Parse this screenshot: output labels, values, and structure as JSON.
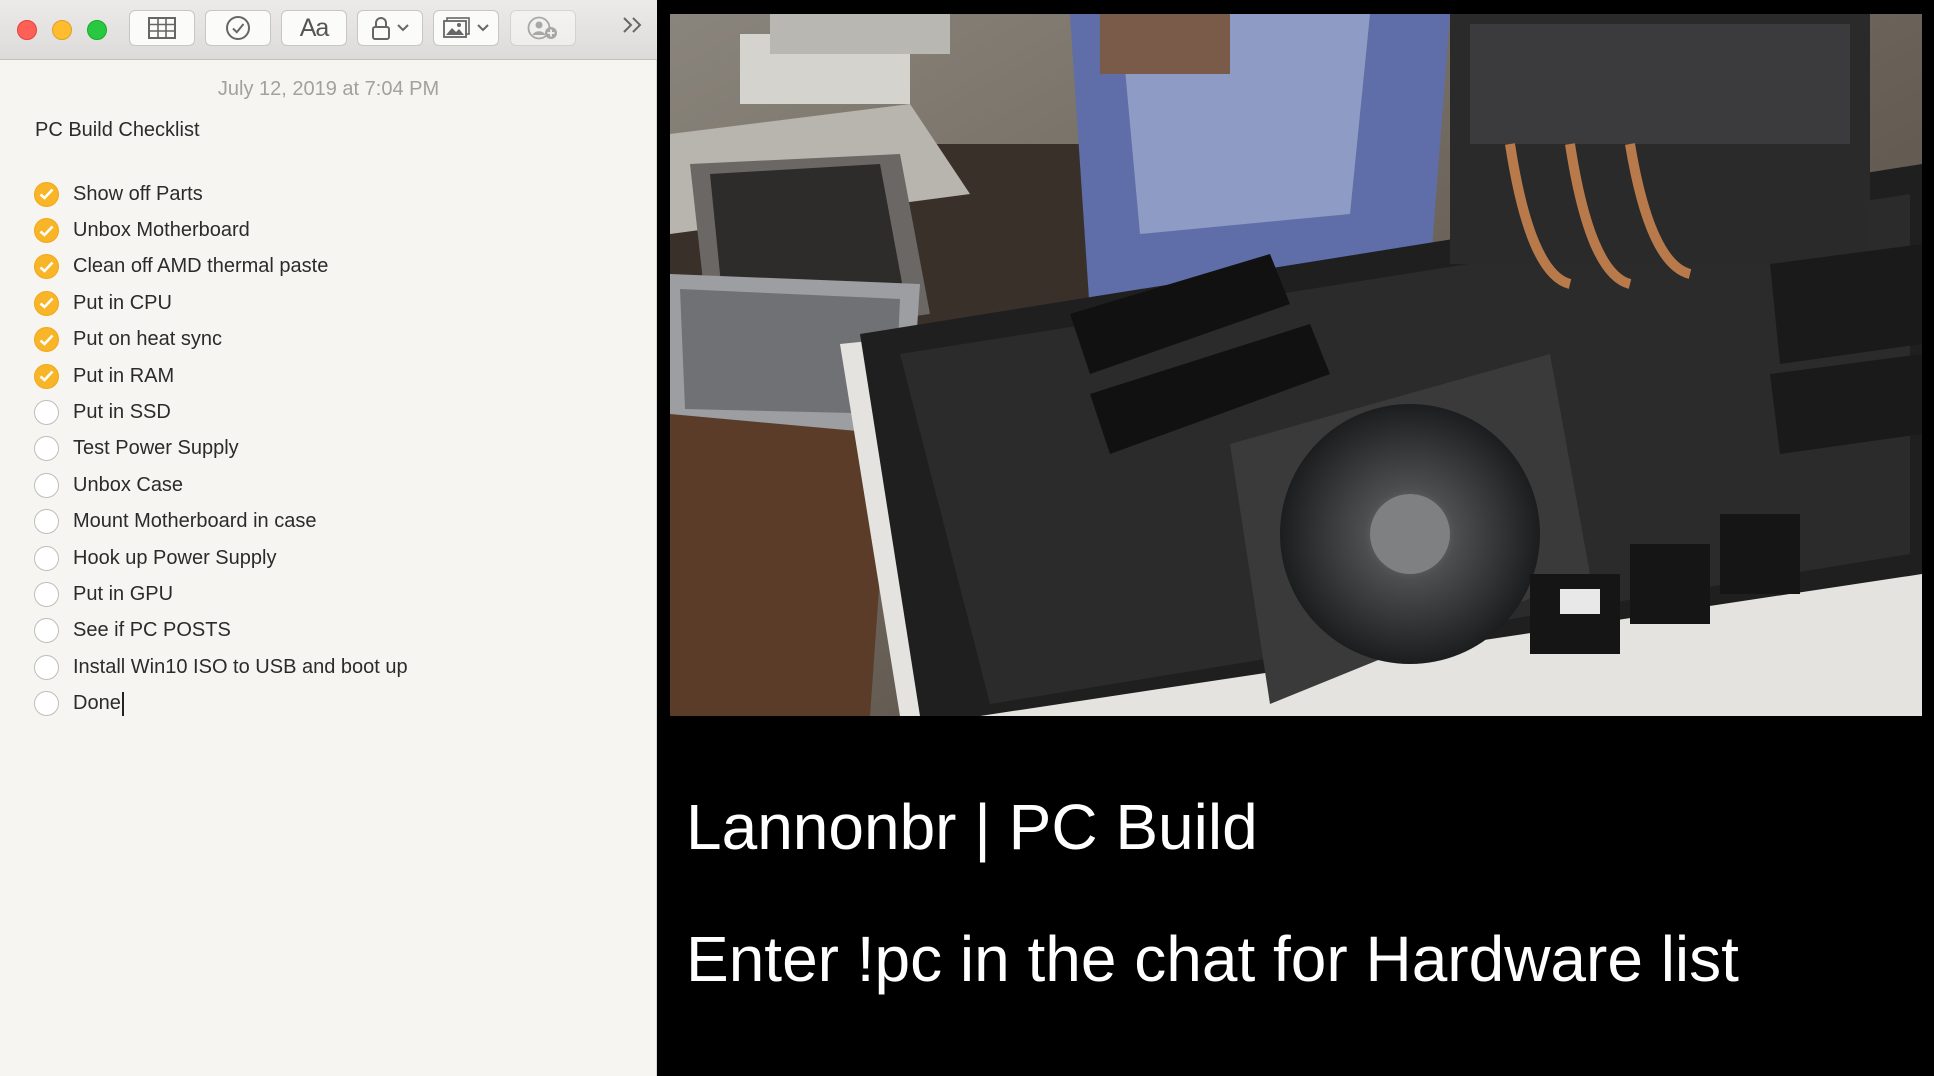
{
  "notes": {
    "toolbar": {
      "aa_label": "Aa",
      "icons": [
        "sidebar-table-icon",
        "checklist-icon",
        "format-icon",
        "lock-icon",
        "media-icon",
        "add-people-icon",
        "more-icon"
      ]
    },
    "date": "July 12, 2019 at 7:04 PM",
    "title": "PC Build Checklist",
    "items": [
      {
        "label": "Show off Parts",
        "done": true
      },
      {
        "label": "Unbox Motherboard",
        "done": true
      },
      {
        "label": "Clean off AMD thermal paste",
        "done": true
      },
      {
        "label": "Put in CPU",
        "done": true
      },
      {
        "label": "Put on heat sync",
        "done": true
      },
      {
        "label": "Put in RAM",
        "done": true
      },
      {
        "label": "Put in SSD",
        "done": false
      },
      {
        "label": "Test Power Supply",
        "done": false
      },
      {
        "label": "Unbox Case",
        "done": false
      },
      {
        "label": "Mount Motherboard in case",
        "done": false
      },
      {
        "label": "Hook up Power Supply",
        "done": false
      },
      {
        "label": "Put in GPU",
        "done": false
      },
      {
        "label": "See if PC POSTS",
        "done": false
      },
      {
        "label": "Install Win10 ISO to USB and boot up",
        "done": false
      },
      {
        "label": "Done",
        "done": false
      }
    ],
    "colors": {
      "check_done": "#f7b527",
      "accent_text": "#2b2b2b"
    }
  },
  "stream": {
    "title": "Lannonbr | PC Build",
    "subtitle": "Enter !pc in the chat for Hardware list"
  }
}
